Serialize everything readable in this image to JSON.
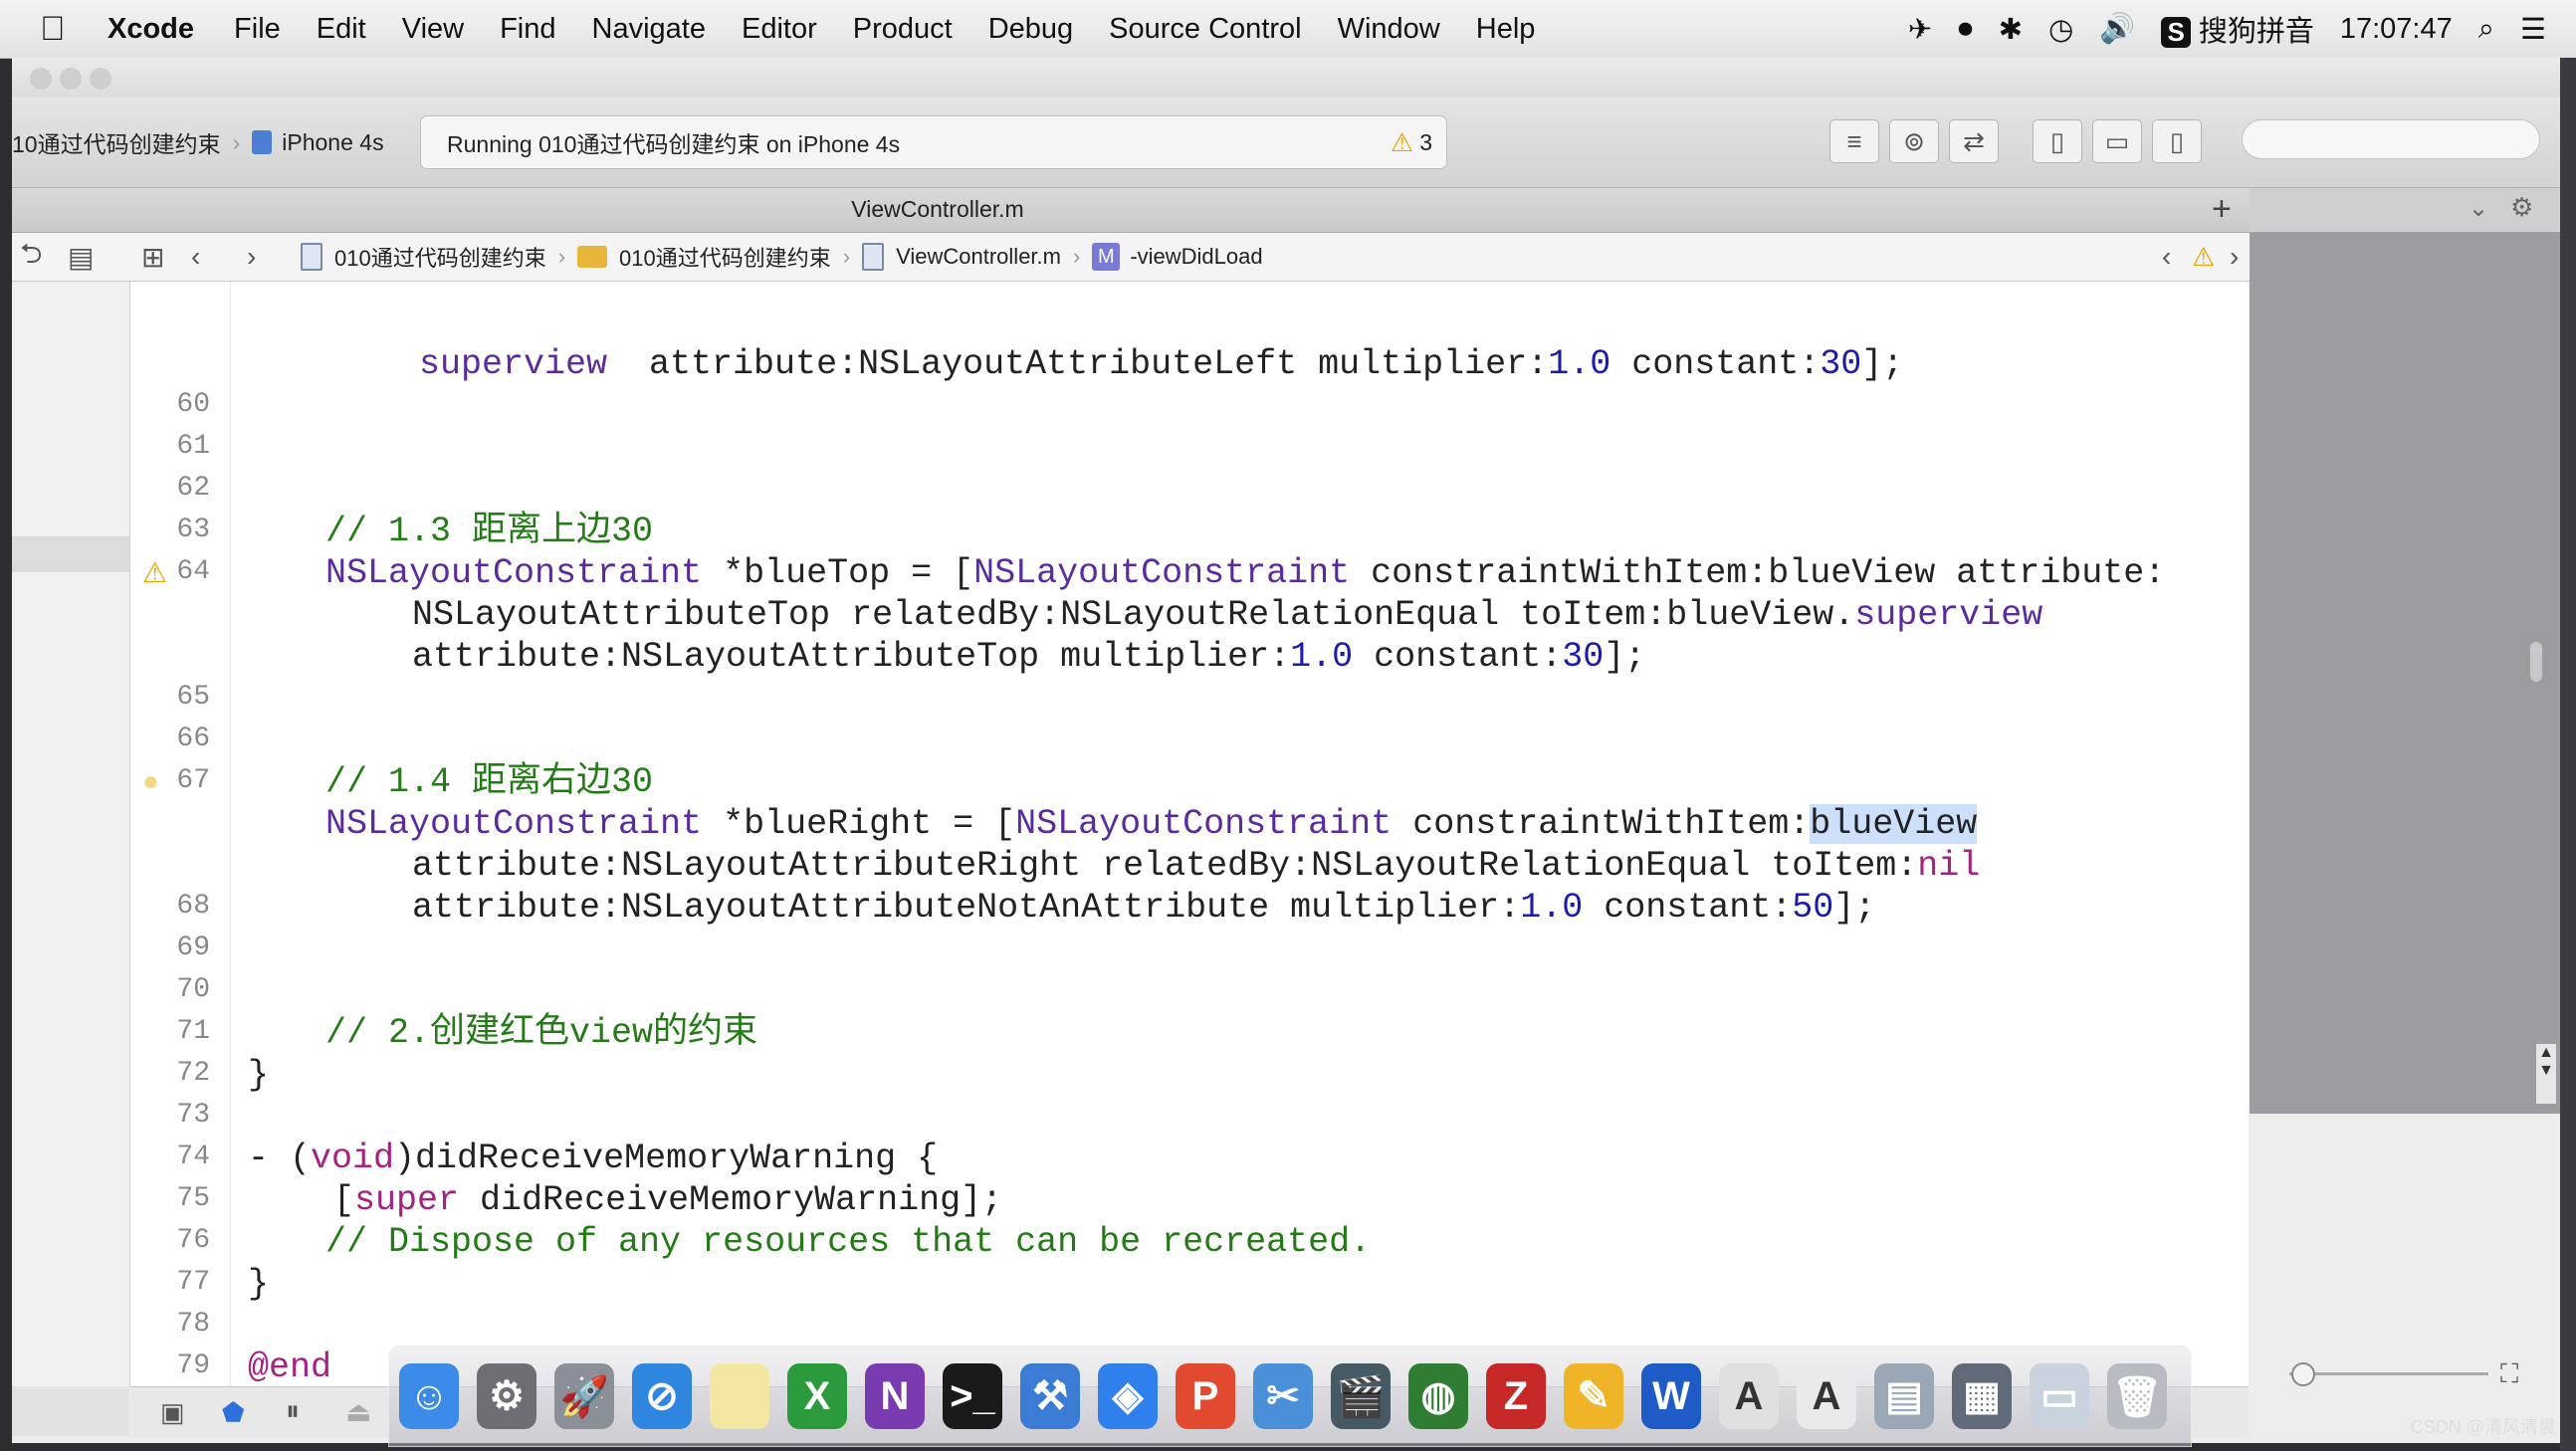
{
  "menubar": {
    "apple": "",
    "app_name": "Xcode",
    "items": [
      "File",
      "Edit",
      "View",
      "Find",
      "Navigate",
      "Editor",
      "Product",
      "Debug",
      "Source Control",
      "Window",
      "Help"
    ],
    "input_method": "搜狗拼音",
    "time": "17:07:47"
  },
  "toolbar": {
    "scheme": "10通过代码创建约束",
    "device": "iPhone 4s",
    "status": "Running 010通过代码创建约束 on iPhone 4s",
    "warning_count": "3"
  },
  "tab": {
    "title": "ViewController.m",
    "add": "+"
  },
  "jumpbar": {
    "project": "010通过代码创建约束",
    "group": "010通过代码创建约束",
    "file": "ViewController.m",
    "method_badge": "M",
    "method": "-viewDidLoad"
  },
  "code": {
    "lines": [
      {
        "no": "",
        "text": "superview  attribute:NSLayoutAttributeLeft multiplier:1.0 constant:30];"
      },
      {
        "no": "60",
        "text": ""
      },
      {
        "no": "61",
        "text": ""
      },
      {
        "no": "62",
        "text": ""
      },
      {
        "no": "63",
        "text": "// 1.3 距离上边30"
      },
      {
        "no": "64",
        "text": "NSLayoutConstraint *blueTop = [NSLayoutConstraint constraintWithItem:blueView attribute:"
      },
      {
        "no": "",
        "text": "NSLayoutAttributeTop relatedBy:NSLayoutRelationEqual toItem:blueView.superview"
      },
      {
        "no": "",
        "text": "attribute:NSLayoutAttributeTop multiplier:1.0 constant:30];"
      },
      {
        "no": "65",
        "text": ""
      },
      {
        "no": "66",
        "text": "// 1.4 距离右边30"
      },
      {
        "no": "67",
        "text": "NSLayoutConstraint *blueRight = [NSLayoutConstraint constraintWithItem:blueView"
      },
      {
        "no": "",
        "text": "attribute:NSLayoutAttributeRight relatedBy:NSLayoutRelationEqual toItem:nil"
      },
      {
        "no": "",
        "text": "attribute:NSLayoutAttributeNotAnAttribute multiplier:1.0 constant:50];"
      },
      {
        "no": "68",
        "text": ""
      },
      {
        "no": "69",
        "text": ""
      },
      {
        "no": "70",
        "text": "// 2.创建红色view的约束"
      },
      {
        "no": "71",
        "text": "}"
      },
      {
        "no": "72",
        "text": ""
      },
      {
        "no": "73",
        "text": "- (void)didReceiveMemoryWarning {"
      },
      {
        "no": "74",
        "text": "[super didReceiveMemoryWarning];"
      },
      {
        "no": "75",
        "text": "// Dispose of any resources that can be recreated."
      },
      {
        "no": "76",
        "text": "}"
      },
      {
        "no": "77",
        "text": ""
      },
      {
        "no": "78",
        "text": "@end"
      },
      {
        "no": "79",
        "text": ""
      }
    ]
  },
  "watermark": "CSDN @清风清晨",
  "colors": {
    "comment": "#237b16",
    "type": "#5b2b9e",
    "keyword": "#a5227f",
    "number": "#1c1ca8",
    "selection": "#cde0fb",
    "warning": "#e8a400"
  }
}
